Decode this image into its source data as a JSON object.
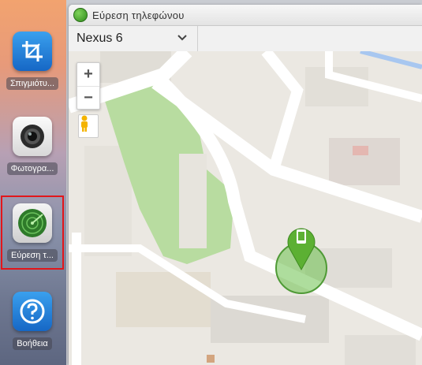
{
  "dock": {
    "items": [
      {
        "label": "Σπιγμιότυ...",
        "icon": "crop-icon"
      },
      {
        "label": "Φωτογρα...",
        "icon": "camera-icon"
      },
      {
        "label": "Εύρεση τ...",
        "icon": "radar-icon",
        "selected": true
      },
      {
        "label": "Βοήθεια",
        "icon": "help-icon"
      }
    ]
  },
  "window": {
    "title": "Εύρεση τηλεφώνου",
    "device_select": {
      "value": "Nexus 6"
    }
  },
  "map": {
    "zoom_in": "+",
    "zoom_out": "−",
    "device_marker_icon": "phone-icon",
    "colors": {
      "park": "#b8dca0",
      "accuracy": "#6cc14d",
      "marker": "#5cb033"
    }
  }
}
